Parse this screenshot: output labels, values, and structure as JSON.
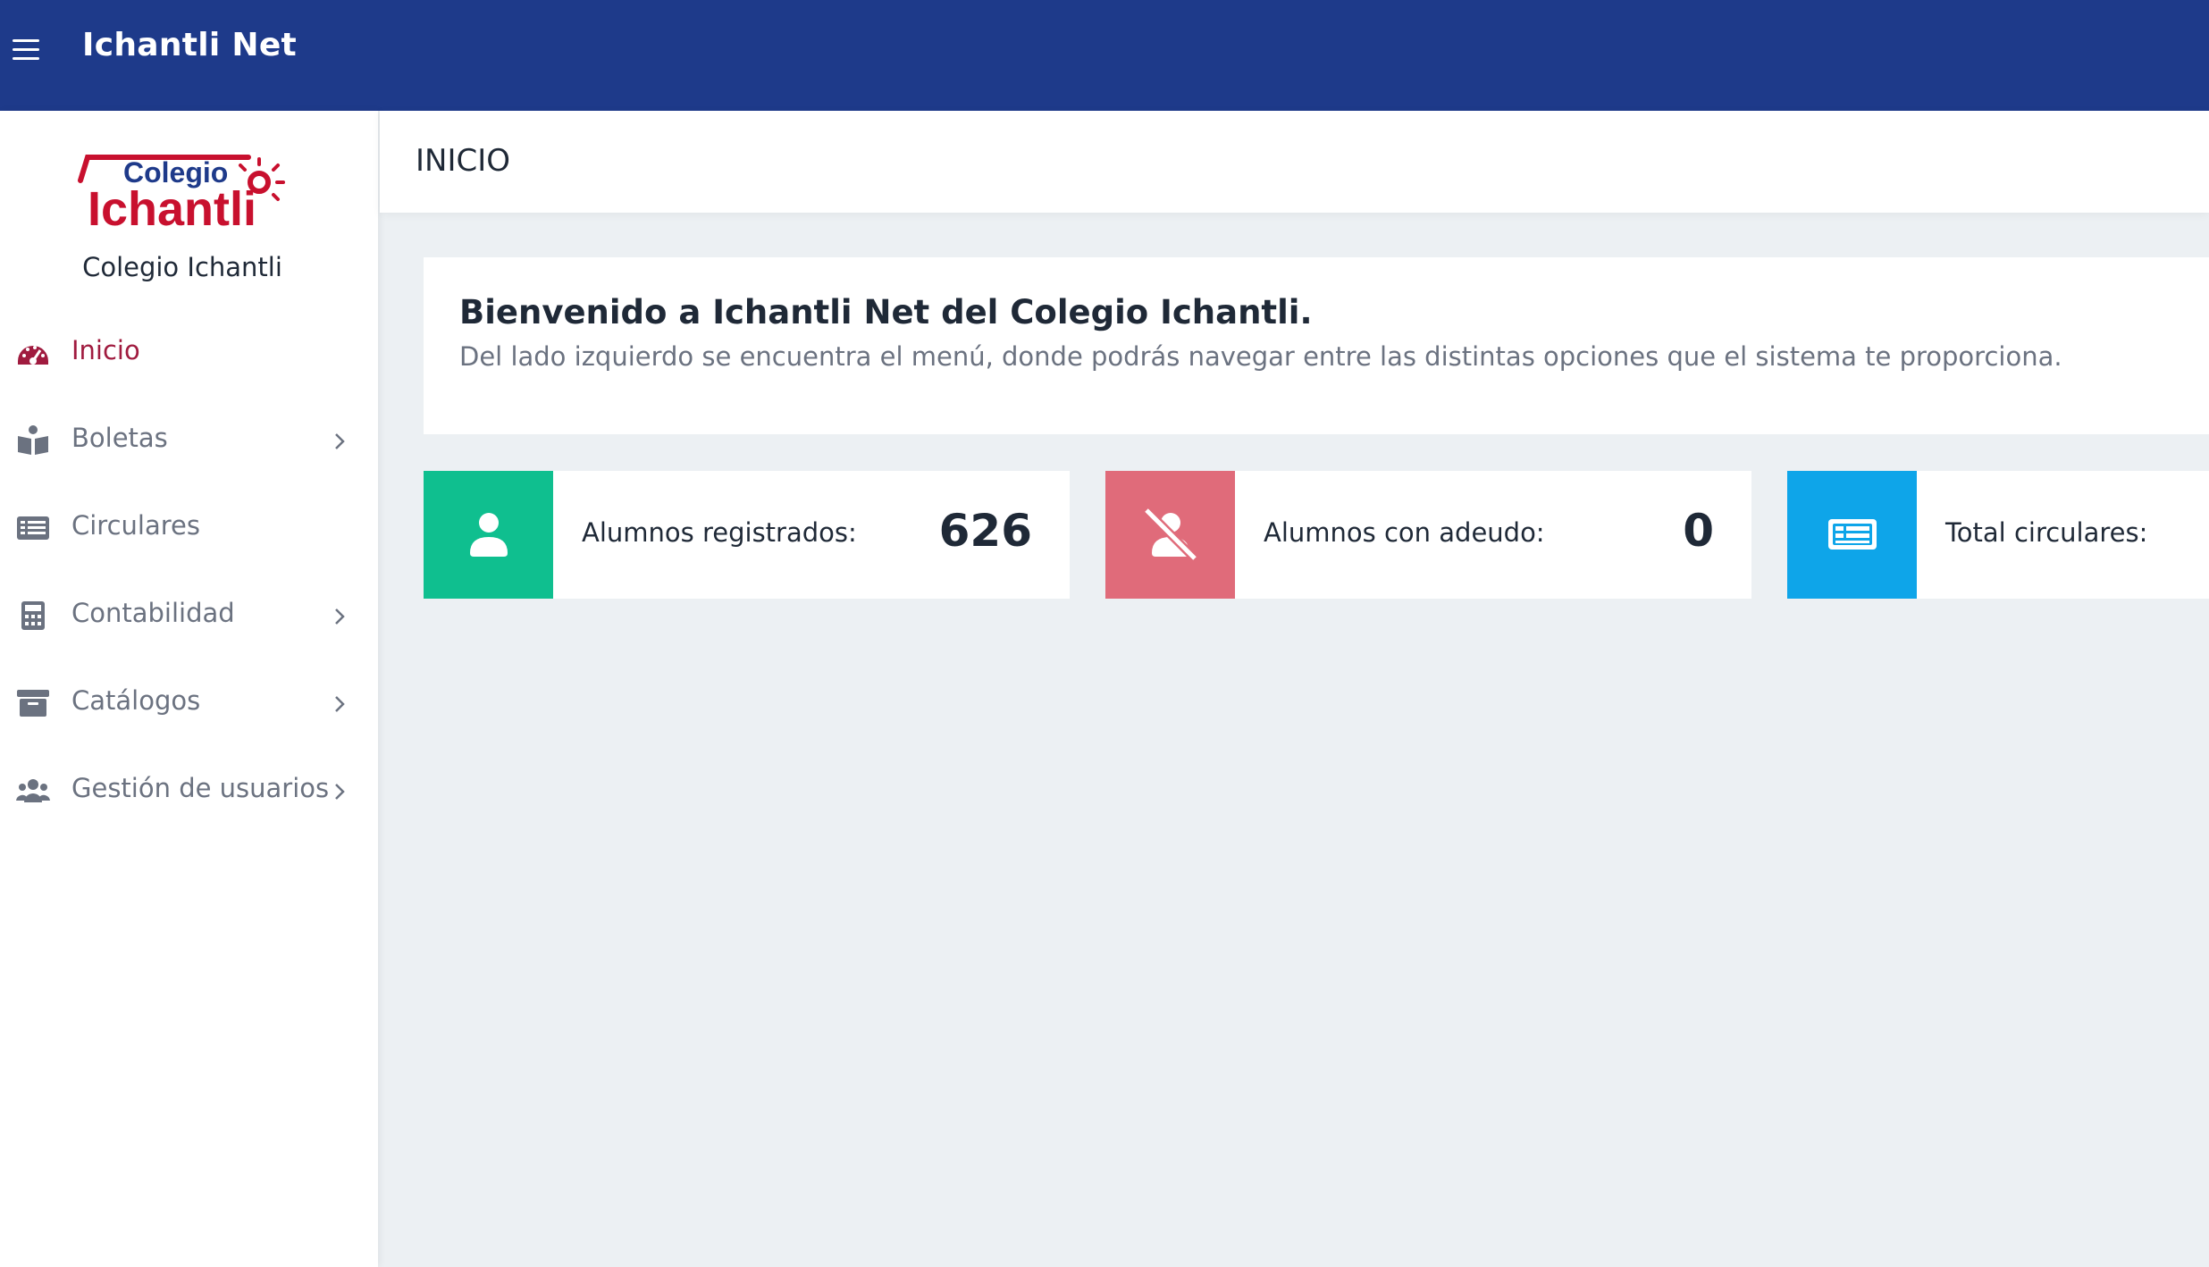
{
  "app": {
    "title": "Ichantli Net"
  },
  "sidebar": {
    "logo_top": "Colegio",
    "logo_bottom": "Ichantli",
    "school_name": "Colegio Ichantli",
    "items": [
      {
        "label": "Inicio",
        "icon": "dashboard-icon",
        "active": true
      },
      {
        "label": "Boletas",
        "icon": "reader-icon",
        "has_submenu": true
      },
      {
        "label": "Circulares",
        "icon": "list-icon",
        "has_submenu": false
      },
      {
        "label": "Contabilidad",
        "icon": "calculator-icon",
        "has_submenu": true
      },
      {
        "label": "Catálogos",
        "icon": "archive-icon",
        "has_submenu": true
      },
      {
        "label": "Gestión de usuarios",
        "icon": "users-icon",
        "has_submenu": true
      }
    ]
  },
  "header": {
    "page_title": "INICIO"
  },
  "welcome": {
    "title": "Bienvenido a Ichantli Net del Colegio Ichantli.",
    "text": "Del lado izquierdo se encuentra el menú, donde podrás navegar entre las distintas opciones que el sistema te proporciona."
  },
  "stats": [
    {
      "label": "Alumnos registrados:",
      "value": "626",
      "icon": "user-icon",
      "color": "#0fbf8f"
    },
    {
      "label": "Alumnos con adeudo:",
      "value": "0",
      "icon": "user-slash-icon",
      "color": "#e06b7a"
    },
    {
      "label": "Total circulares:",
      "value": "",
      "icon": "newspaper-icon",
      "color": "#0ea5e9"
    }
  ],
  "colors": {
    "topbar": "#1e3a8a",
    "active": "#a01b3f",
    "background": "#ecf0f3"
  }
}
